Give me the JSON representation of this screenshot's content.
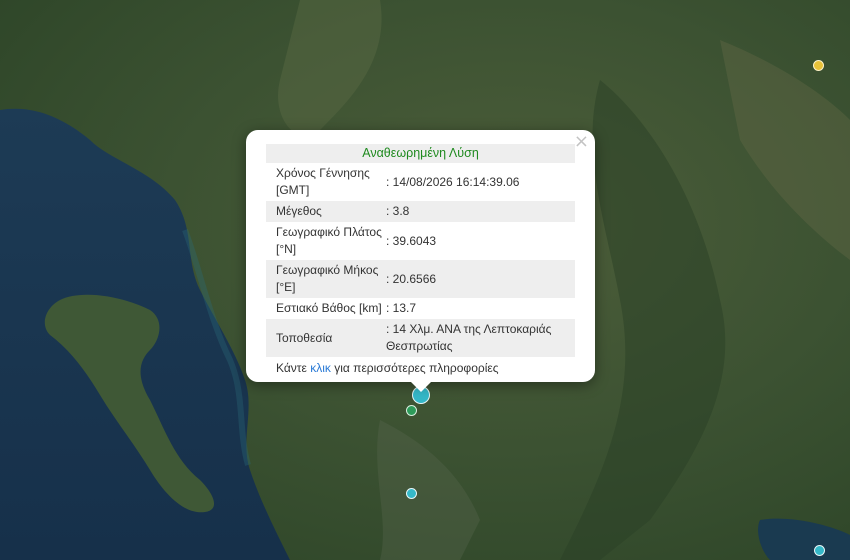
{
  "popup": {
    "title": "Αναθεωρημένη Λύση",
    "close_glyph": "×",
    "rows": [
      {
        "label": "Χρόνος Γέννησης [GMT]",
        "value": ": 14/08/2026 16:14:39.06"
      },
      {
        "label": "Μέγεθος",
        "value": ": 3.8"
      },
      {
        "label": "Γεωγραφικό Πλάτος [°N]",
        "value": ": 39.6043"
      },
      {
        "label": "Γεωγραφικό Μήκος [°E]",
        "value": ": 20.6566"
      },
      {
        "label": "Εστιακό Βάθος [km]",
        "value": ": 13.7"
      },
      {
        "label": "Τοποθεσία",
        "value": ": 14 Χλμ. ΑΝΑ της Λεπτοκαριάς Θεσπρωτίας"
      }
    ],
    "footer_prefix": "Κάντε ",
    "footer_link": "κλικ",
    "footer_suffix": " για περισσότερες πληροφορίες"
  },
  "colors": {
    "title_green": "#1f8a1f",
    "link_blue": "#2a7ad6",
    "marker_cyan": "#35b8c8",
    "marker_green": "#2e9b5a",
    "marker_yellow": "#e8c23a"
  }
}
